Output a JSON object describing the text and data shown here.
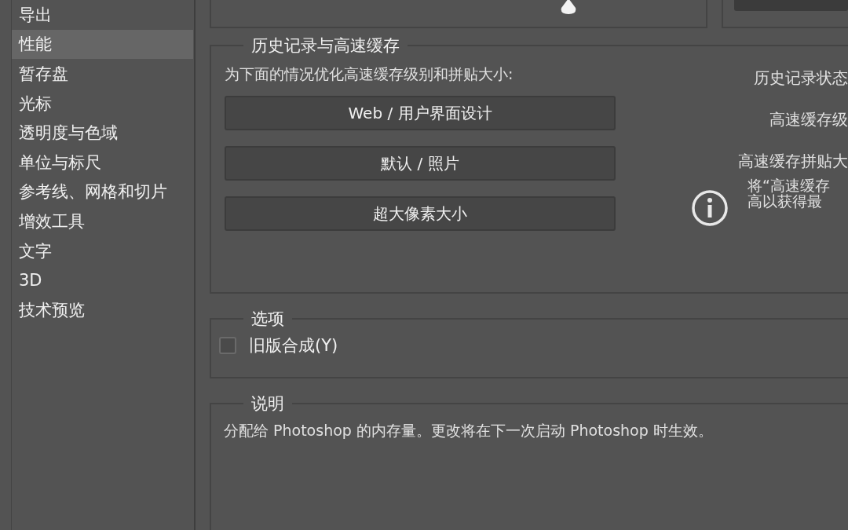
{
  "sidebar": {
    "items": [
      {
        "label": "导出",
        "selected": false
      },
      {
        "label": "性能",
        "selected": true
      },
      {
        "label": "暂存盘",
        "selected": false
      },
      {
        "label": "光标",
        "selected": false
      },
      {
        "label": "透明度与色域",
        "selected": false
      },
      {
        "label": "单位与标尺",
        "selected": false
      },
      {
        "label": "参考线、网格和切片",
        "selected": false
      },
      {
        "label": "增效工具",
        "selected": false
      },
      {
        "label": "文字",
        "selected": false
      },
      {
        "label": "3D",
        "selected": false
      },
      {
        "label": "技术预览",
        "selected": false
      }
    ]
  },
  "history_cache": {
    "title": "历史记录与高速缓存",
    "prompt": "为下面的情况优化高速缓存级别和拼贴大小:",
    "presets": [
      "Web / 用户界面设计",
      "默认 / 照片",
      "超大像素大小"
    ],
    "fields": [
      "历史记录状态",
      "高速缓存级",
      "高速缓存拼贴大"
    ],
    "info_lines": [
      "将“高速缓存",
      "高以获得最"
    ]
  },
  "options": {
    "title": "选项",
    "checkbox": {
      "label": "旧版合成(Y)",
      "checked": false
    }
  },
  "description": {
    "title": "说明",
    "text": "分配给 Photoshop 的内存量。更改将在下一次启动 Photoshop 时生效。"
  }
}
